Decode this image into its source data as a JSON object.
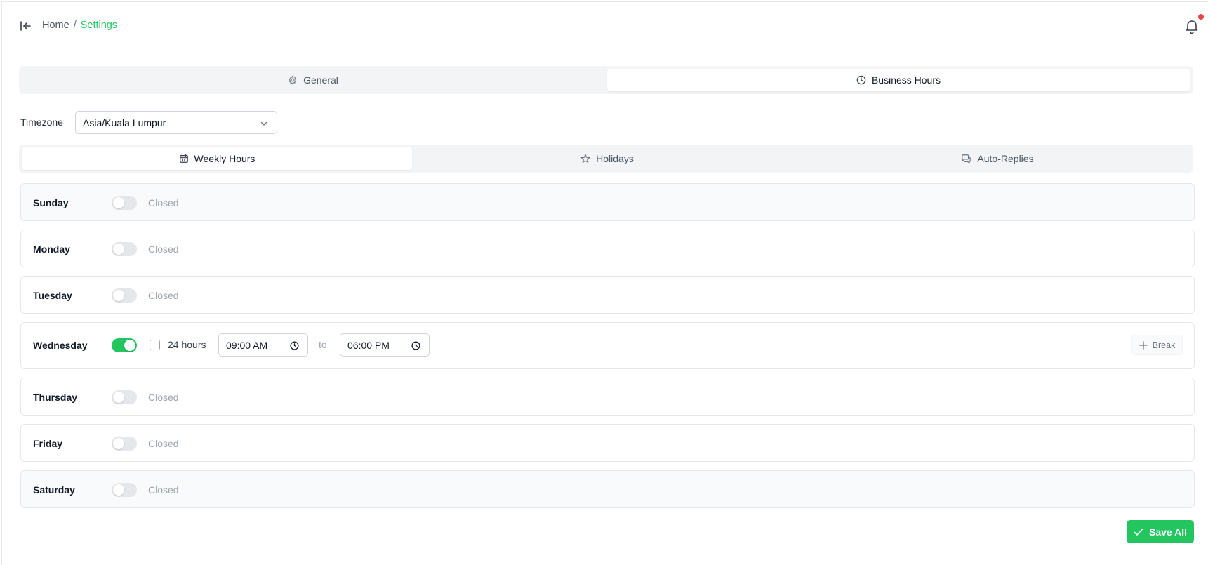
{
  "breadcrumb": {
    "home": "Home",
    "separator": "/",
    "current": "Settings"
  },
  "top_tabs": [
    {
      "label": "General",
      "icon": "gear-icon",
      "active": false
    },
    {
      "label": "Business Hours",
      "icon": "clock-icon",
      "active": true
    }
  ],
  "timezone": {
    "label": "Timezone",
    "value": "Asia/Kuala Lumpur"
  },
  "sub_tabs": [
    {
      "label": "Weekly Hours",
      "icon": "calendar-icon",
      "active": true
    },
    {
      "label": "Holidays",
      "icon": "star-icon",
      "active": false
    },
    {
      "label": "Auto-Replies",
      "icon": "chat-icon",
      "active": false
    }
  ],
  "days": [
    {
      "name": "Sunday",
      "enabled": false,
      "status": "Closed"
    },
    {
      "name": "Monday",
      "enabled": false,
      "status": "Closed"
    },
    {
      "name": "Tuesday",
      "enabled": false,
      "status": "Closed"
    },
    {
      "name": "Wednesday",
      "enabled": true,
      "all_day_label": "24 hours",
      "all_day": false,
      "open": "09:00 AM",
      "to_label": "to",
      "close": "06:00 PM",
      "break_label": "Break"
    },
    {
      "name": "Thursday",
      "enabled": false,
      "status": "Closed"
    },
    {
      "name": "Friday",
      "enabled": false,
      "status": "Closed"
    },
    {
      "name": "Saturday",
      "enabled": false,
      "status": "Closed"
    }
  ],
  "save_label": "Save All",
  "colors": {
    "accent": "#22c55e",
    "notification_dot": "#ef4444"
  }
}
